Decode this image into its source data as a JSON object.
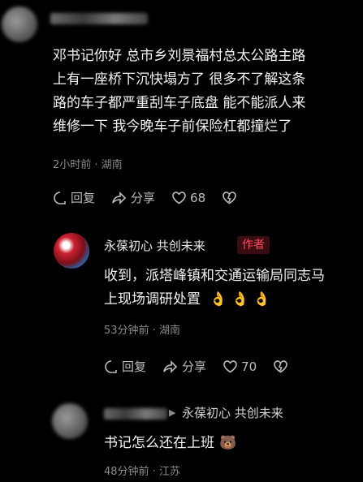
{
  "comment1": {
    "text_lines": [
      "邓书记你好  总市乡刘景福村总太公路主路",
      "上有一座桥下沉快塌方了  很多不了解这条",
      "路的车子都严重刮车子底盘  能不能派人来",
      "维修一下  我今晚车子前保险杠都撞烂了"
    ],
    "meta": "2小时前 · 湖南",
    "reply_label": "回复",
    "share_label": "分享",
    "like_count": "68"
  },
  "reply1": {
    "username": "永葆初心 共创未来",
    "badge": "作者",
    "text_line1": "收到，派塔峰镇和交通运输局同志马",
    "text_line2": "上现场调研处置",
    "emojis": "👌 👌 👌",
    "meta": "53分钟前 · 湖南",
    "reply_label": "回复",
    "share_label": "分享",
    "like_count": "70"
  },
  "reply2": {
    "reply_to": "永葆初心 共创未来",
    "text": "书记怎么还在上班",
    "emoji": "🐻",
    "meta": "48分钟前 · 江苏"
  }
}
